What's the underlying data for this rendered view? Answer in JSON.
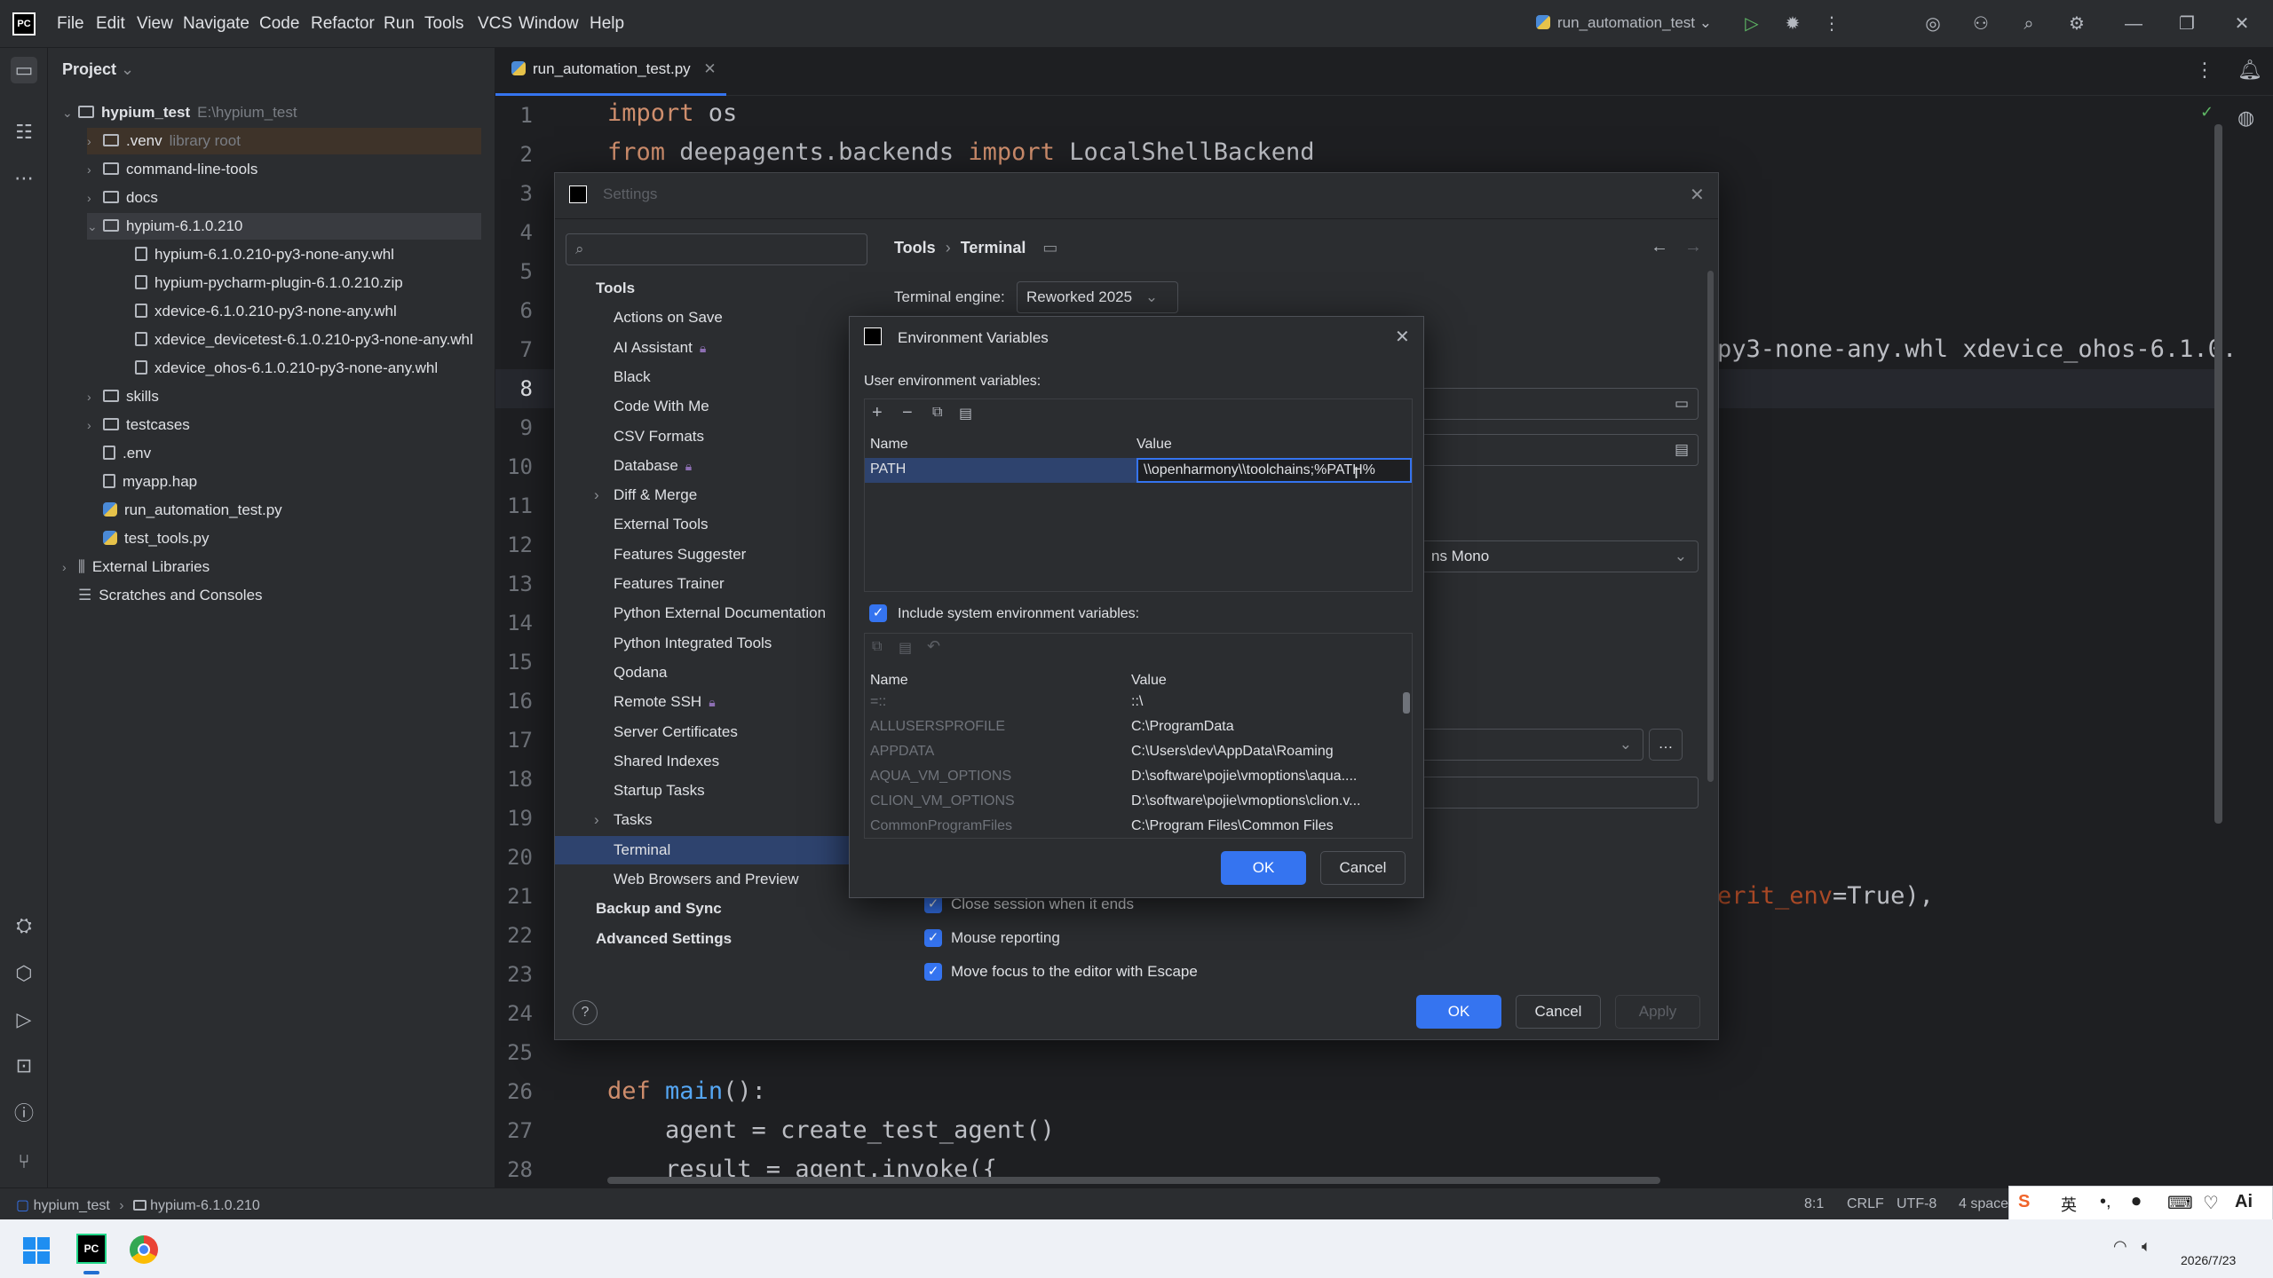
{
  "menu": [
    "File",
    "Edit",
    "View",
    "Navigate",
    "Code",
    "Refactor",
    "Run",
    "Tools",
    "VCS",
    "Window",
    "Help"
  ],
  "run_config": "run_automation_test",
  "project_panel": {
    "title": "Project",
    "tree": [
      {
        "label": "hypium_test",
        "suffix": "E:\\hypium_test",
        "type": "folder"
      },
      {
        "label": ".venv",
        "suffix": "library root",
        "type": "folder"
      },
      {
        "label": "command-line-tools",
        "type": "folder"
      },
      {
        "label": "docs",
        "type": "folder"
      },
      {
        "label": "hypium-6.1.0.210",
        "type": "folder"
      },
      {
        "label": "hypium-6.1.0.210-py3-none-any.whl",
        "type": "file"
      },
      {
        "label": "hypium-pycharm-plugin-6.1.0.210.zip",
        "type": "file"
      },
      {
        "label": "xdevice-6.1.0.210-py3-none-any.whl",
        "type": "file"
      },
      {
        "label": "xdevice_devicetest-6.1.0.210-py3-none-any.whl",
        "type": "file"
      },
      {
        "label": "xdevice_ohos-6.1.0.210-py3-none-any.whl",
        "type": "file"
      },
      {
        "label": "skills",
        "type": "folder"
      },
      {
        "label": "testcases",
        "type": "folder"
      },
      {
        "label": ".env",
        "type": "file"
      },
      {
        "label": "myapp.hap",
        "type": "file"
      },
      {
        "label": "run_automation_test.py",
        "type": "py"
      },
      {
        "label": "test_tools.py",
        "type": "py"
      },
      {
        "label": "External Libraries",
        "type": "lib"
      },
      {
        "label": "Scratches and Consoles",
        "type": "scratch"
      }
    ]
  },
  "editor": {
    "tab": "run_automation_test.py",
    "line_numbers": [
      "1",
      "2",
      "3",
      "4",
      "5",
      "6",
      "7",
      "8",
      "9",
      "10",
      "11",
      "12",
      "13",
      "14",
      "15",
      "16",
      "17",
      "18",
      "19",
      "20",
      "21",
      "22",
      "23",
      "24",
      "25",
      "26",
      "27",
      "28"
    ],
    "line1_kw": "import",
    "line1_rest": " os",
    "line2_kw1": "from",
    "line2_mid": " deepagents.backends ",
    "line2_kw2": "import",
    "line2_rest": " LocalShellBackend",
    "line7_tail": "py3-none-any.whl xdevice_ohos-6.1.0.",
    "line21_tail_a": "erit_env",
    "line21_tail_b": "=True),",
    "line26_kw": "def",
    "line26_fn": "main",
    "line26_rest": "():",
    "line27": "    agent = create_test_agent()",
    "line28": "    result = agent.invoke({"
  },
  "settings": {
    "title": "Settings",
    "search_placeholder": "",
    "breadcrumb_a": "Tools",
    "breadcrumb_sep": "›",
    "breadcrumb_b": "Terminal",
    "engine_label": "Terminal engine:",
    "engine_value": "Reworked 2025",
    "font_tail": "ns Mono",
    "nav": [
      {
        "label": "Tools",
        "head": true
      },
      {
        "label": "Actions on Save"
      },
      {
        "label": "AI Assistant",
        "lock": true
      },
      {
        "label": "Black"
      },
      {
        "label": "Code With Me"
      },
      {
        "label": "CSV Formats"
      },
      {
        "label": "Database",
        "lock": true
      },
      {
        "label": "Diff & Merge",
        "expand": true
      },
      {
        "label": "External Tools"
      },
      {
        "label": "Features Suggester"
      },
      {
        "label": "Features Trainer"
      },
      {
        "label": "Python External Documentation"
      },
      {
        "label": "Python Integrated Tools"
      },
      {
        "label": "Qodana"
      },
      {
        "label": "Remote SSH",
        "lock": true
      },
      {
        "label": "Server Certificates"
      },
      {
        "label": "Shared Indexes"
      },
      {
        "label": "Startup Tasks"
      },
      {
        "label": "Tasks",
        "expand": true
      },
      {
        "label": "Terminal",
        "selected": true
      },
      {
        "label": "Web Browsers and Preview"
      },
      {
        "label": "Backup and Sync",
        "head": true
      },
      {
        "label": "Advanced Settings",
        "head": true
      }
    ],
    "checks": [
      "Close session when it ends",
      "Mouse reporting",
      "Move focus to the editor with Escape"
    ],
    "ok": "OK",
    "cancel": "Cancel",
    "apply": "Apply"
  },
  "env_dialog": {
    "title": "Environment Variables",
    "user_label": "User environment variables:",
    "col_name": "Name",
    "col_value": "Value",
    "user_row_name": "PATH",
    "user_row_value": "\\\\openharmony\\\\toolchains;%PATH%",
    "include_label": "Include system environment variables:",
    "system_rows": [
      {
        "name": "=::",
        "value": "::\\"
      },
      {
        "name": "ALLUSERSPROFILE",
        "value": "C:\\ProgramData"
      },
      {
        "name": "APPDATA",
        "value": "C:\\Users\\dev\\AppData\\Roaming"
      },
      {
        "name": "AQUA_VM_OPTIONS",
        "value": "D:\\software\\pojie\\vmoptions\\aqua...."
      },
      {
        "name": "CLION_VM_OPTIONS",
        "value": "D:\\software\\pojie\\vmoptions\\clion.v..."
      },
      {
        "name": "CommonProgramFiles",
        "value": "C:\\Program Files\\Common Files"
      }
    ],
    "ok": "OK",
    "cancel": "Cancel"
  },
  "statusbar": {
    "crumb_a": "hypium_test",
    "crumb_b": "hypium-6.1.0.210",
    "position": "8:1",
    "line_sep": "CRLF",
    "encoding": "UTF-8",
    "indent": "4 spaces"
  },
  "taskbar": {
    "date": "2026/7/23",
    "ime": "英"
  }
}
